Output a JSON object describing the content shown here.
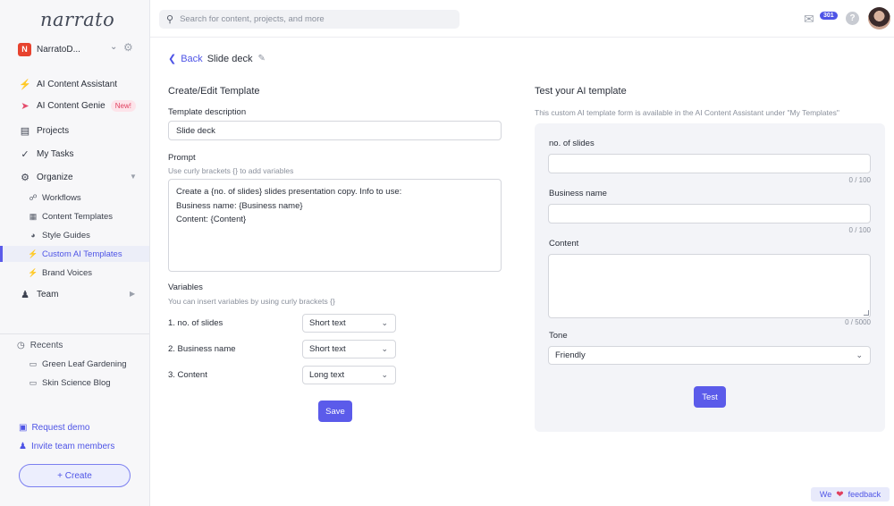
{
  "app": {
    "logo": "narrato"
  },
  "sidebar": {
    "workspace": {
      "badge": "N",
      "name": "NarratoD..."
    },
    "items": [
      {
        "label": "AI Content Assistant"
      },
      {
        "label": "AI Content Genie",
        "badge": "New!"
      },
      {
        "label": "Projects"
      },
      {
        "label": "My Tasks"
      },
      {
        "label": "Organize"
      },
      {
        "label": "Team"
      }
    ],
    "organize_items": [
      {
        "label": "Workflows"
      },
      {
        "label": "Content Templates"
      },
      {
        "label": "Style Guides"
      },
      {
        "label": "Custom AI Templates"
      },
      {
        "label": "Brand Voices"
      }
    ],
    "recents": {
      "title": "Recents",
      "items": [
        {
          "label": "Green Leaf Gardening"
        },
        {
          "label": "Skin Science Blog"
        }
      ]
    },
    "footer": {
      "request_demo": "Request demo",
      "invite": "Invite team members",
      "create": "+ Create"
    }
  },
  "topbar": {
    "search_placeholder": "Search for content, projects, and more",
    "mail_count": "301",
    "help": "?"
  },
  "page": {
    "back_label": "Back",
    "title": "Slide deck"
  },
  "form": {
    "section_title": "Create/Edit Template",
    "description_label": "Template description",
    "description_value": "Slide deck",
    "prompt_label": "Prompt",
    "prompt_hint": "Use curly brackets {} to add variables",
    "prompt_lines": [
      "Create a {no. of slides} slides presentation copy. Info to use:",
      "Business name: {Business name}",
      "Content: {Content}"
    ],
    "variables_label": "Variables",
    "variables_hint": "You can insert variables by using curly brackets {}",
    "variables": [
      {
        "label": "1. no. of slides",
        "type": "Short text"
      },
      {
        "label": "2. Business name",
        "type": "Short text"
      },
      {
        "label": "3. Content",
        "type": "Long text"
      }
    ],
    "save": "Save"
  },
  "test": {
    "title": "Test your AI template",
    "subtitle": "This custom AI template form is available in the AI Content Assistant under \"My Templates\"",
    "fields": [
      {
        "label": "no. of slides",
        "counter": "0 / 100"
      },
      {
        "label": "Business name",
        "counter": "0 / 100"
      },
      {
        "label": "Content",
        "counter": "0 / 5000"
      }
    ],
    "tone_label": "Tone",
    "tone_value": "Friendly",
    "test_button": "Test"
  },
  "feedback": {
    "prefix": "We",
    "suffix": "feedback"
  }
}
